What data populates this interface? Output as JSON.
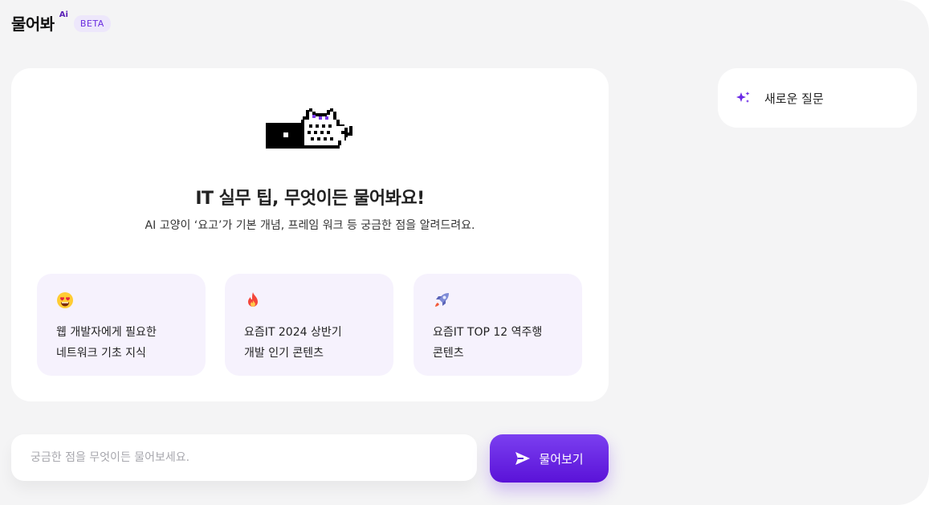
{
  "header": {
    "title": "물어봐",
    "ai_tag": "Ai",
    "beta_label": "BETA"
  },
  "hero": {
    "title": "IT 실무 팁, 무엇이든 물어봐요!",
    "subtitle": "AI 고양이 ‘요고’가 기본 개념, 프레임 워크 등 궁금한 점을 알려드려요."
  },
  "suggestions": [
    {
      "icon": "heart-eyes-emoji-icon",
      "text": "웹 개발자에게 필요한\n네트워크 기초 지식"
    },
    {
      "icon": "fire-emoji-icon",
      "text": "요즘IT 2024 상반기\n개발 인기 콘텐츠"
    },
    {
      "icon": "rocket-emoji-icon",
      "text": "요즘IT TOP 12 역주행\n콘텐츠"
    }
  ],
  "sidebar": {
    "new_question_label": "새로운 질문",
    "new_question_icon": "sparkle-icon"
  },
  "composer": {
    "placeholder": "궁금한 점을 무엇이든 물어보세요.",
    "value": "",
    "submit_label": "물어보기",
    "submit_icon": "send-icon"
  },
  "colors": {
    "accent": "#6a28e6",
    "badge_bg": "#ede7fb",
    "card_bg": "#f6f2fd",
    "app_bg": "#f4f4f5"
  }
}
